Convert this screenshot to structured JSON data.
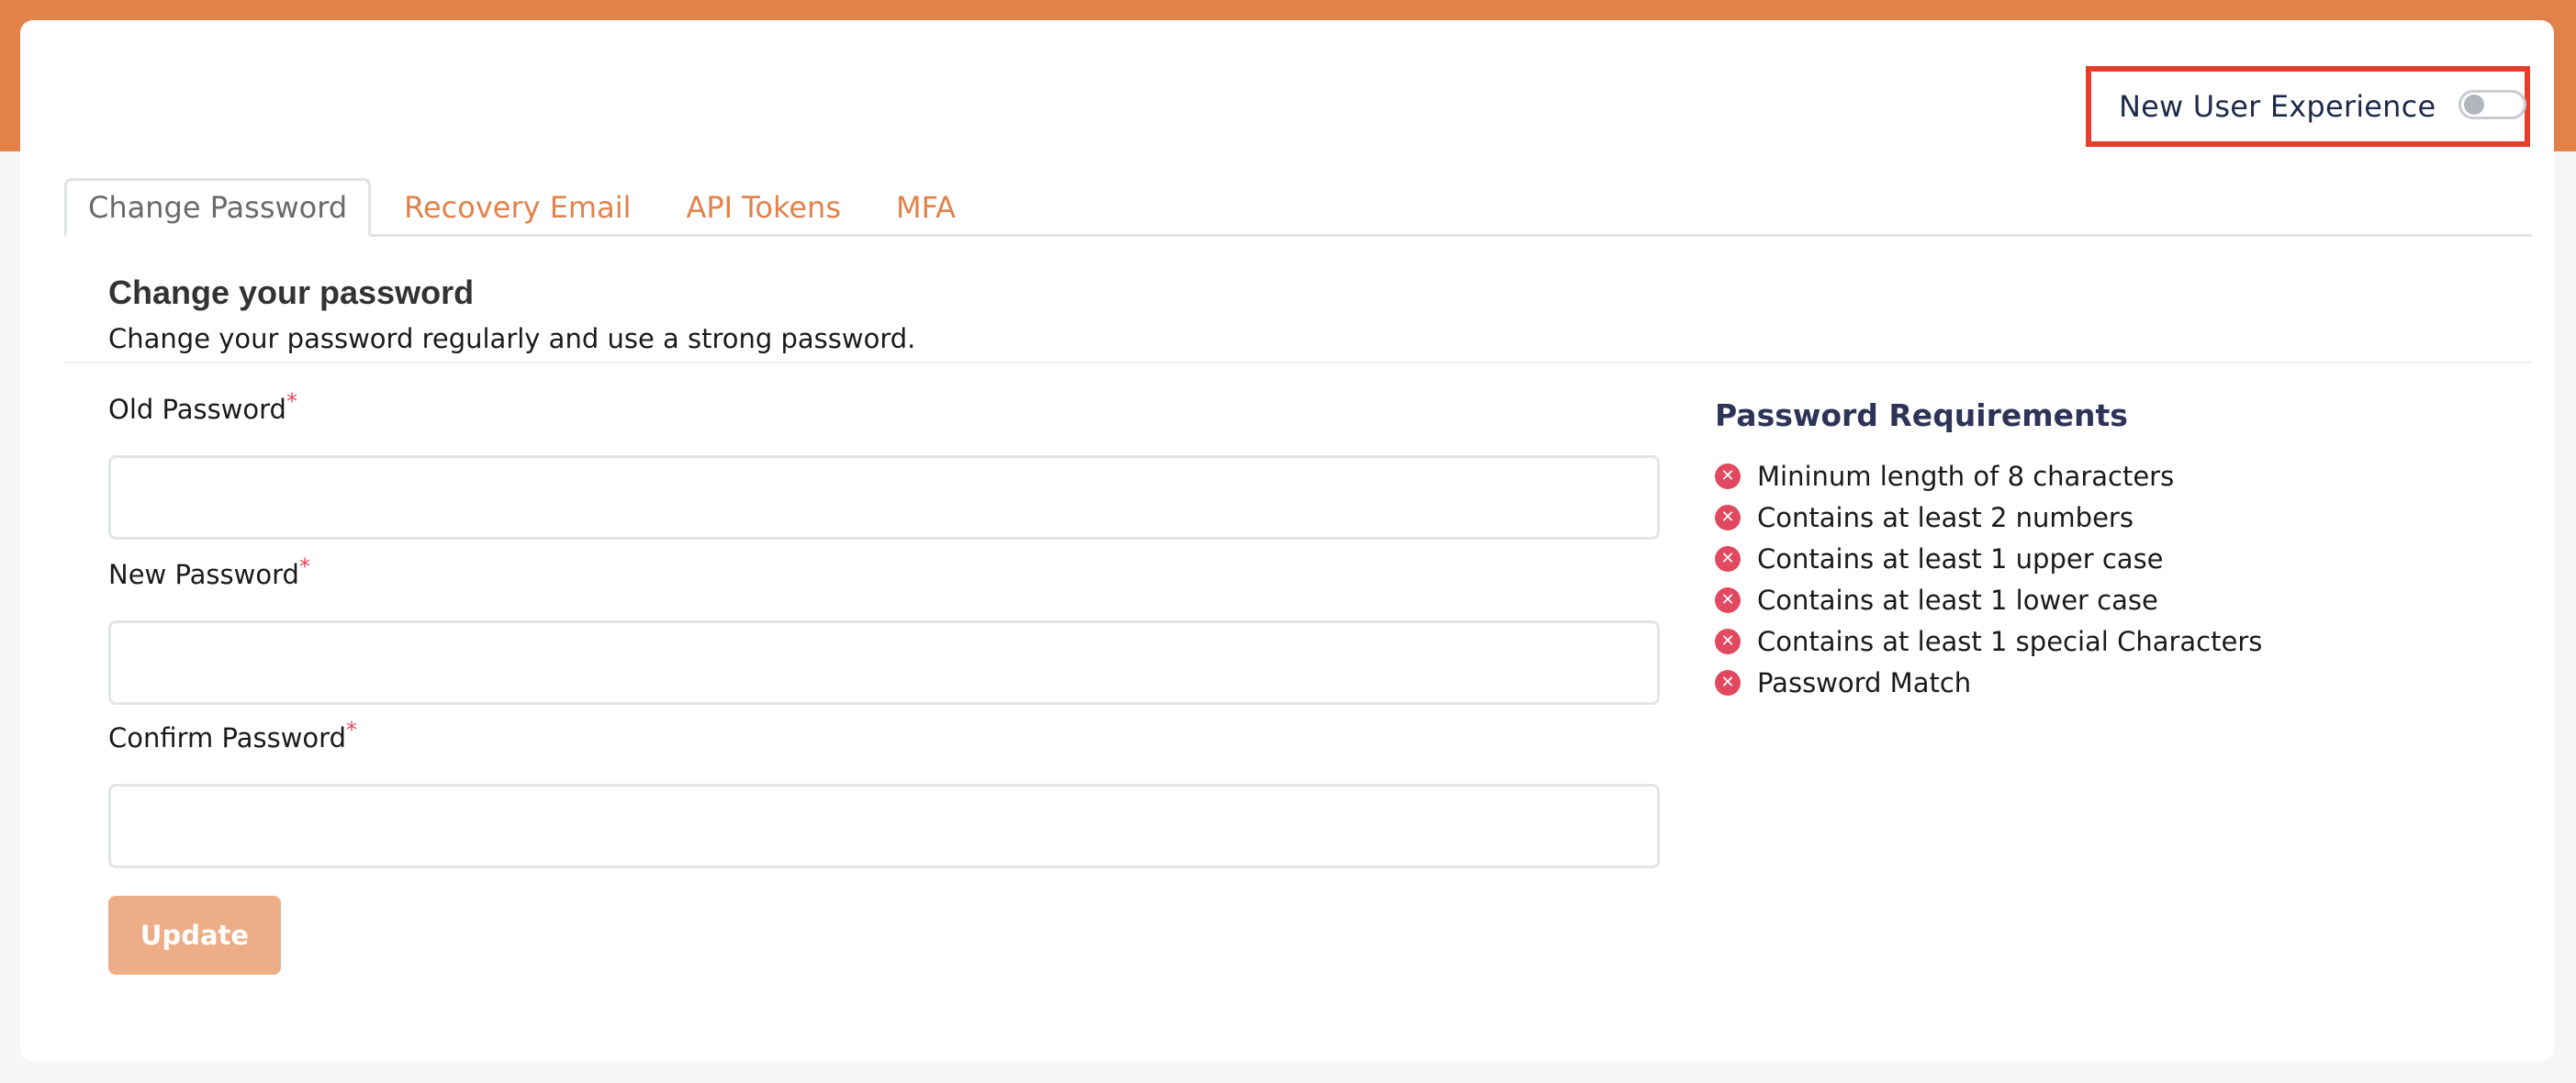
{
  "header": {
    "new_user_experience_label": "New User Experience",
    "new_user_experience_enabled": false
  },
  "tabs": [
    {
      "label": "Change Password",
      "active": true
    },
    {
      "label": "Recovery Email",
      "active": false
    },
    {
      "label": "API Tokens",
      "active": false
    },
    {
      "label": "MFA",
      "active": false
    }
  ],
  "section": {
    "title": "Change your password",
    "subtitle": "Change your password regularly and use a strong password."
  },
  "form": {
    "fields": [
      {
        "label": "Old Password",
        "required_marker": "*",
        "value": "",
        "placeholder": ""
      },
      {
        "label": "New Password",
        "required_marker": "*",
        "value": "",
        "placeholder": ""
      },
      {
        "label": "Confirm Password",
        "required_marker": "*",
        "value": "",
        "placeholder": ""
      }
    ],
    "submit_label": "Update"
  },
  "requirements": {
    "title": "Password Requirements",
    "status_icon": "x-circle-icon",
    "items": [
      {
        "label": "Mininum length of 8 characters",
        "met": false
      },
      {
        "label": "Contains at least 2 numbers",
        "met": false
      },
      {
        "label": "Contains at least 1 upper case",
        "met": false
      },
      {
        "label": "Contains at least 1 lower case",
        "met": false
      },
      {
        "label": "Contains at least 1 special Characters",
        "met": false
      },
      {
        "label": "Password Match",
        "met": false
      }
    ]
  },
  "colors": {
    "brand_orange": "#e2824a",
    "button_disabled": "#edae87",
    "highlight_box": "#e63e2a",
    "error_red": "#e0495f",
    "requirements_title": "#2d3458"
  }
}
